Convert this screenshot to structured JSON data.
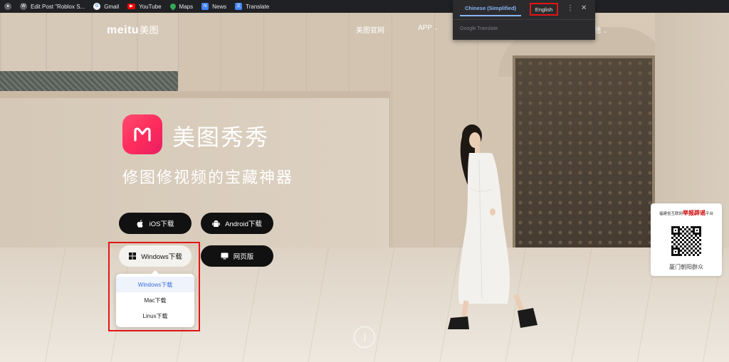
{
  "bookmarks": [
    {
      "label": "",
      "icon": "globe-icon",
      "color": "#5f6368"
    },
    {
      "label": "Edit Post \"Roblox S...",
      "icon": "wordpress-icon",
      "color": "#5f6368"
    },
    {
      "label": "Gmail",
      "icon": "google-icon",
      "color": "#ffffff"
    },
    {
      "label": "YouTube",
      "icon": "youtube-icon",
      "color": "#ff0000"
    },
    {
      "label": "Maps",
      "icon": "maps-icon",
      "color": "#34a853"
    },
    {
      "label": "News",
      "icon": "news-icon",
      "color": "#4285f4"
    },
    {
      "label": "Translate",
      "icon": "translate-icon",
      "color": "#4285f4"
    }
  ],
  "header": {
    "logo_latin": "meitu",
    "logo_cn": "美图",
    "nav": {
      "official": "美图官网",
      "app": "APP",
      "other": "他"
    }
  },
  "translate_popup": {
    "source_lang": "Chinese (Simplified)",
    "target_lang": "English",
    "more": "⋮",
    "close": "✕",
    "powered_by": "Google Translate"
  },
  "hero": {
    "app_name": "美图秀秀",
    "tagline": "修图修视频的宝藏神器",
    "brand_color": "#ff2d5c"
  },
  "buttons": {
    "ios": "iOS下载",
    "android": "Android下载",
    "windows": "Windows下载",
    "web": "网页版"
  },
  "dropdown": {
    "items": [
      "Windows下载",
      "Mac下载",
      "Linux下载"
    ],
    "active_index": 0
  },
  "qr_card": {
    "top_prefix": "福建省互联网",
    "top_highlight": "举报辟谣",
    "top_suffix": "平台",
    "caption": "厦门朝阳群众"
  },
  "highlight_color": "#e01616"
}
